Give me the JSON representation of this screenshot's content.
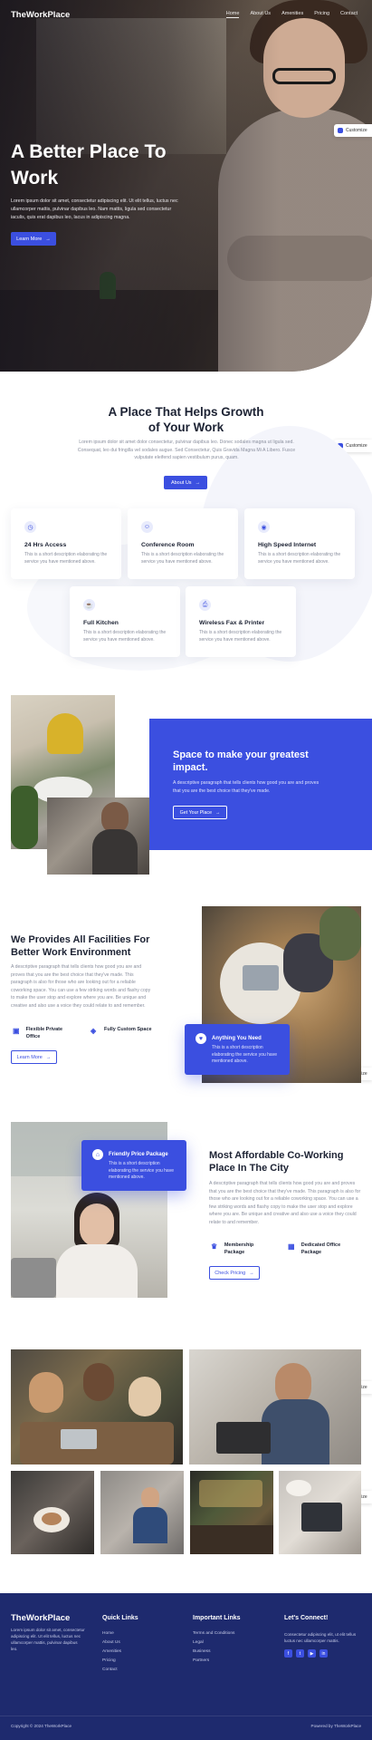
{
  "nav": {
    "logo": "TheWorkPlace",
    "items": [
      "Home",
      "About Us",
      "Amenities",
      "Pricing",
      "Contact"
    ]
  },
  "hero": {
    "title": "A Better Place To Work",
    "text": "Lorem ipsum dolor sit amet, consectetur adipiscing elit. Ut elit tellus, luctus nec ullamcorper mattis, pulvinar dapibus leo. Nam mattis, ligula sed consectetur iaculis, quis erat dapibus leo, lacus in adipiscing magna.",
    "button": "Learn More"
  },
  "customize_label": "Customize",
  "intro": {
    "title": "A Place That Helps Growth of Your Work",
    "text": "Lorem ipsum dolor sit amet dolor consectetur, pulvinar dapibus leo. Donec sodales magna ut ligula sed. Consequat, leo dui fringilla vel sodales augue. Sed Consectetur, Quis Gravida Magna Mi A Libero. Fusce vulputate eleifend sapien vestibulum purus, quam.",
    "button": "About Us"
  },
  "features": [
    {
      "title": "24 Hrs Access",
      "text": "This is a short description elaborating the service you have mentioned above.",
      "icon": "clock-icon"
    },
    {
      "title": "Conference Room",
      "text": "This is a short description elaborating the service you have mentioned above.",
      "icon": "people-icon"
    },
    {
      "title": "High Speed Internet",
      "text": "This is a short description elaborating the service you have mentioned above.",
      "icon": "wifi-icon"
    },
    {
      "title": "Full Kitchen",
      "text": "This is a short description elaborating the service you have mentioned above.",
      "icon": "cup-icon"
    },
    {
      "title": "Wireless Fax & Printer",
      "text": "This is a short description elaborating the service you have mentioned above.",
      "icon": "printer-icon"
    }
  ],
  "impact": {
    "title": "Space to make your greatest impact.",
    "text": "A descriptive paragraph that tells clients how good you are and proves that you are the best choice that they've made.",
    "button": "Get Your Place"
  },
  "facilities": {
    "title": "We Provides All Facilities For Better Work Environment",
    "text": "A descriptive paragraph that tells clients how good you are and proves that you are the best choice that they've made. This paragraph is also for those who are looking out for a reliable coworking space. You can use a few striking words and flashy copy to make the user stop and explore where you are. Be unique and creative and also use a voice they could relate to and remember.",
    "items": [
      {
        "label": "Flexible Private Office",
        "icon": "briefcase-icon"
      },
      {
        "label": "Fully Custom Space",
        "icon": "layers-icon"
      }
    ],
    "button": "Learn More",
    "box_title": "Anything You Need",
    "box_text": "This is a short description elaborating the service you have mentioned above."
  },
  "pricing": {
    "title": "Most Affordable Co-Working Place In The City",
    "text": "A descriptive paragraph that tells clients how good you are and proves that you are the best choice that they've made. This paragraph is also for those who are looking out for a reliable coworking space. You can use a few striking words and flashy copy to make the user stop and explore where you are. Be unique and creative and also use a voice they could relate to and remember.",
    "items": [
      {
        "label": "Membership Package",
        "icon": "trophy-icon"
      },
      {
        "label": "Dedicated Office Package",
        "icon": "desk-icon"
      }
    ],
    "button": "Check Pricing",
    "box_title": "Friendly Price Package",
    "box_text": "This is a short description elaborating the service you have mentioned above."
  },
  "footer": {
    "logo": "TheWorkPlace",
    "desc": "Lorem ipsum dolor sit amet, consectetur adipiscing elit. Ut elit tellus, luctus nec ullamcorper mattis, pulvinar dapibus leo.",
    "quick_title": "Quick Links",
    "quick_links": [
      "Home",
      "About Us",
      "Amenities",
      "Pricing",
      "Contact"
    ],
    "important_title": "Important Links",
    "important_links": [
      "Terms and Conditions",
      "Legal",
      "Business",
      "Partners"
    ],
    "connect_title": "Let's Connect!",
    "connect_text": "Consectetur adipiscing elit, ut elit tellus luctus nec ullamcorper mattis.",
    "copyright": "Copyright © 2024 TheWorkPlace",
    "powered": "Powered by TheWorkPlace"
  },
  "colors": {
    "accent": "#3b4fe0",
    "footer": "#1e2a6e",
    "heading": "#1c2233",
    "muted": "#8a8f9e"
  }
}
